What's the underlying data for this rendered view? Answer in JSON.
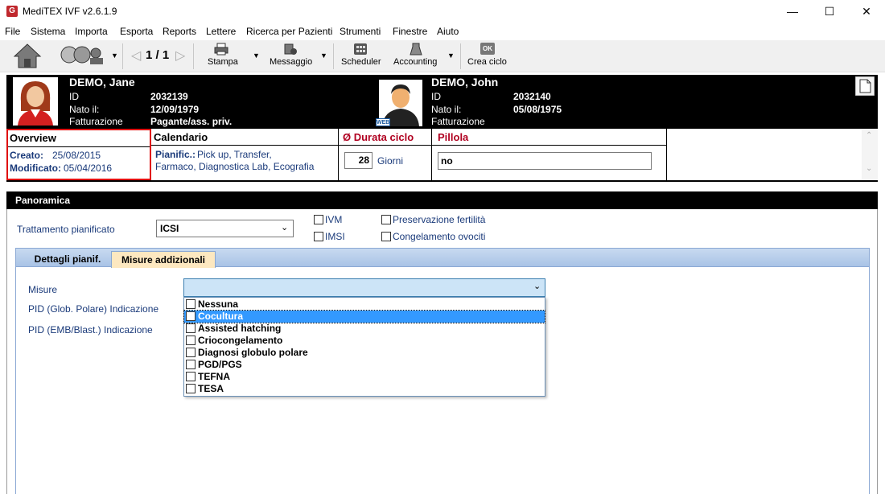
{
  "window": {
    "title": "MediTEX IVF v2.6.1.9",
    "controls": [
      "minimize",
      "maximize",
      "close"
    ]
  },
  "menu": [
    "File",
    "Sistema",
    "Importa",
    "Esporta",
    "Reports",
    "Lettere",
    "Ricerca per Pazienti",
    "Strumenti",
    "Finestre",
    "Aiuto"
  ],
  "toolbar": {
    "pager": "1 / 1",
    "stampa": "Stampa",
    "messaggio": "Messaggio",
    "scheduler": "Scheduler",
    "accounting": "Accounting",
    "crea_ciclo": "Crea ciclo",
    "ok_badge": "OK"
  },
  "patient_female": {
    "name": "DEMO, Jane",
    "id_label": "ID",
    "id": "2032139",
    "birth_label": "Nato il:",
    "birth": "12/09/1979",
    "billing_label": "Fatturazione",
    "billing": "Pagante/ass. priv."
  },
  "patient_male": {
    "name": "DEMO, John",
    "id_label": "ID",
    "id": "2032140",
    "birth_label": "Nato il:",
    "birth": "05/08/1975",
    "billing_label": "Fatturazione",
    "web_badge": "WEB"
  },
  "overview": {
    "title": "Overview",
    "created_label": "Creato:",
    "created": "25/08/2015",
    "modified_label": "Modificato:",
    "modified": "05/04/2016"
  },
  "calendario": {
    "title": "Calendario",
    "planned_label": "Pianific.:",
    "planned_line1": "Pick up, Transfer,",
    "planned_line2": "Farmaco, Diagnostica Lab, Ecografia"
  },
  "durata": {
    "title": "Ø Durata ciclo",
    "value": "28",
    "unit": "Giorni"
  },
  "pillola": {
    "title": "Pillola",
    "value": "no"
  },
  "panoramica": {
    "title": "Panoramica",
    "treatment_label": "Trattamento pianificato",
    "treatment_value": "ICSI",
    "checkboxes": {
      "ivm": "IVM",
      "imsi": "IMSI",
      "preservazione": "Preservazione fertilità",
      "congelamento": "Congelamento ovociti"
    },
    "tabs": [
      "Dettagli pianif.",
      "Misure addizionali"
    ],
    "active_tab": "Misure addizionali",
    "misure_label": "Misure",
    "misure_value": "",
    "pid_polar_label": "PID (Glob. Polare) Indicazione",
    "pid_emb_label": "PID (EMB/Blast.) Indicazione",
    "dropdown_options": [
      "Nessuna",
      "Cocultura",
      "Assisted hatching",
      "Criocongelamento",
      "Diagnosi globulo polare",
      "PGD/PGS",
      "TEFNA",
      "TESA"
    ],
    "highlighted_option": "Cocultura"
  },
  "colors": {
    "accent_red": "#b00020",
    "highlight_blue": "#3399ff",
    "label_blue": "#1a3a7a",
    "tab_active": "#fde8c0"
  }
}
